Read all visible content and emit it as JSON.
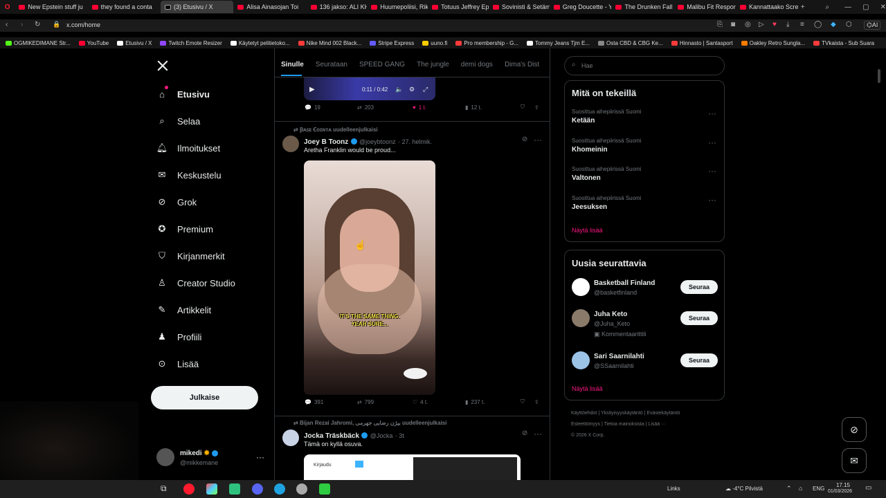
{
  "browser": {
    "tabs": [
      {
        "label": "New Epstein stuff ju",
        "fav": "yt"
      },
      {
        "label": "they found a conta",
        "fav": "yt"
      },
      {
        "label": "(3) Etusivu / X",
        "fav": "x",
        "active": true
      },
      {
        "label": "Alisa Ainasojan Toi",
        "fav": "yt"
      },
      {
        "label": "136 jakso: ALI KHAN",
        "fav": "yt"
      },
      {
        "label": "Huumepoliisi, Riko",
        "fav": "yt"
      },
      {
        "label": "Totuus Jeffrey Epste",
        "fav": "yt"
      },
      {
        "label": "Sovinisti & Setämi",
        "fav": "yt"
      },
      {
        "label": "Greg Doucette - Yo",
        "fav": "yt"
      },
      {
        "label": "The Drunken Fall of",
        "fav": "yt"
      },
      {
        "label": "Malibu Fit Respond",
        "fav": "yt"
      },
      {
        "label": "Kannattaako Screa",
        "fav": "yt"
      }
    ],
    "url": "x.com/home",
    "ai_label": "AI",
    "bookmarks": [
      {
        "label": "OGMIKEDIMANE Str...",
        "color": "#53fc18"
      },
      {
        "label": "YouTube",
        "color": "#ff0033"
      },
      {
        "label": "Etusivu / X",
        "color": "#ffffff"
      },
      {
        "label": "Twitch Emote Resizer",
        "color": "#9146ff"
      },
      {
        "label": "Käytetyt pelitietoko...",
        "color": "#ffffff"
      },
      {
        "label": "Nike Mind 002 Black...",
        "color": "#ff3b3b"
      },
      {
        "label": "Stripe Express",
        "color": "#635bff"
      },
      {
        "label": "uuno.fi",
        "color": "#ffcc00"
      },
      {
        "label": "Pro membership - G...",
        "color": "#ff3b3b"
      },
      {
        "label": "Tommy Jeans Tjm E...",
        "color": "#ffffff"
      },
      {
        "label": "Osta CBD & CBG Ke...",
        "color": "#888888"
      },
      {
        "label": "Hinnasto | Santasport",
        "color": "#ff3b3b"
      },
      {
        "label": "Oakley Retro Sungla...",
        "color": "#ff7a00"
      },
      {
        "label": "TVkaista - Sub Suara",
        "color": "#ff3b3b"
      }
    ]
  },
  "sidebar": {
    "items": [
      {
        "label": "Etusivu",
        "icon": "home-icon",
        "bold": true
      },
      {
        "label": "Selaa",
        "icon": "search-icon"
      },
      {
        "label": "Ilmoitukset",
        "icon": "bell-icon"
      },
      {
        "label": "Keskustelu",
        "icon": "mail-icon"
      },
      {
        "label": "Grok",
        "icon": "grok-icon"
      },
      {
        "label": "Premium",
        "icon": "premium-icon"
      },
      {
        "label": "Kirjanmerkit",
        "icon": "bookmark-icon"
      },
      {
        "label": "Creator Studio",
        "icon": "creator-icon"
      },
      {
        "label": "Artikkelit",
        "icon": "article-icon"
      },
      {
        "label": "Profiili",
        "icon": "profile-icon"
      },
      {
        "label": "Lisää",
        "icon": "more-icon"
      }
    ],
    "post_label": "Julkaise",
    "account": {
      "name": "mikedi",
      "handle": "@mikkemane"
    }
  },
  "feed": {
    "tabs": [
      "Sinulle",
      "Seurataan",
      "SPEED GANG",
      "The jungle",
      "demi dogs",
      "Dima's Dist"
    ],
    "post0": {
      "time": "0:11 / 0:42",
      "replies": "19",
      "reposts": "203",
      "likes": "1 t.",
      "views": "12 t."
    },
    "post1": {
      "repost_note": "Ꞵᴀꜱᴇ Ꞓᴏɪɴᴛᴀ uudelleenjulkaisi",
      "name": "Joey B Toonz",
      "handle": "@joeybtoonz",
      "date": "· 27. helmik.",
      "text": "Aretha Franklin would be proud...",
      "caption": "IT'S THE SAME THING. YEAH SURE...",
      "replies": "391",
      "reposts": "799",
      "likes": "4 t.",
      "views": "237 t."
    },
    "post2": {
      "repost_note": "Bijan Rezai Jahromi, بیژن رضایی جهرمی uudelleenjulkaisi",
      "name": "Jocka Träskbäck",
      "handle": "@Jocka",
      "date": "· 3t",
      "text": "Tämä on kyllä osuva.",
      "embed_label": "Kirjaudu"
    }
  },
  "right": {
    "search_placeholder": "Hae",
    "trends_title": "Mitä on tekeillä",
    "trends": [
      {
        "sub": "Suosittua aihepiirissä Suomi",
        "name": "Ketään"
      },
      {
        "sub": "Suosittua aihepiirissä Suomi",
        "name": "Khomeinin"
      },
      {
        "sub": "Suosittua aihepiirissä Suomi",
        "name": "Valtonen"
      },
      {
        "sub": "Suosittua aihepiirissä Suomi",
        "name": "Jeesuksen"
      }
    ],
    "show_more": "Näytä lisää",
    "who_title": "Uusia seurattavia",
    "who": [
      {
        "name": "Basketball Finland",
        "handle": "@basketfinland",
        "extra": ""
      },
      {
        "name": "Juha Keto",
        "handle": "@Juha_Keto",
        "extra": "Kommentaarittili"
      },
      {
        "name": "Sari Saarnilahti",
        "handle": "@SSaarnilahti",
        "extra": ""
      }
    ],
    "follow_label": "Seuraa",
    "footer": [
      "Käyttöehdot",
      "Yksityisyyskäytäntö",
      "Evästekäytäntö",
      "Esteettömyys",
      "Tietoa mainoksista",
      "Lisää ···",
      "© 2026 X Corp."
    ]
  },
  "taskbar": {
    "links": "Links",
    "weather": "-4°C  Pilvistä",
    "lang": "ENG",
    "time": "17.15",
    "date": "01/03/2026"
  },
  "colors": {
    "accent": "#f91880",
    "verified": "#1d9bf0",
    "bg": "#000000",
    "border": "#2f3336"
  }
}
